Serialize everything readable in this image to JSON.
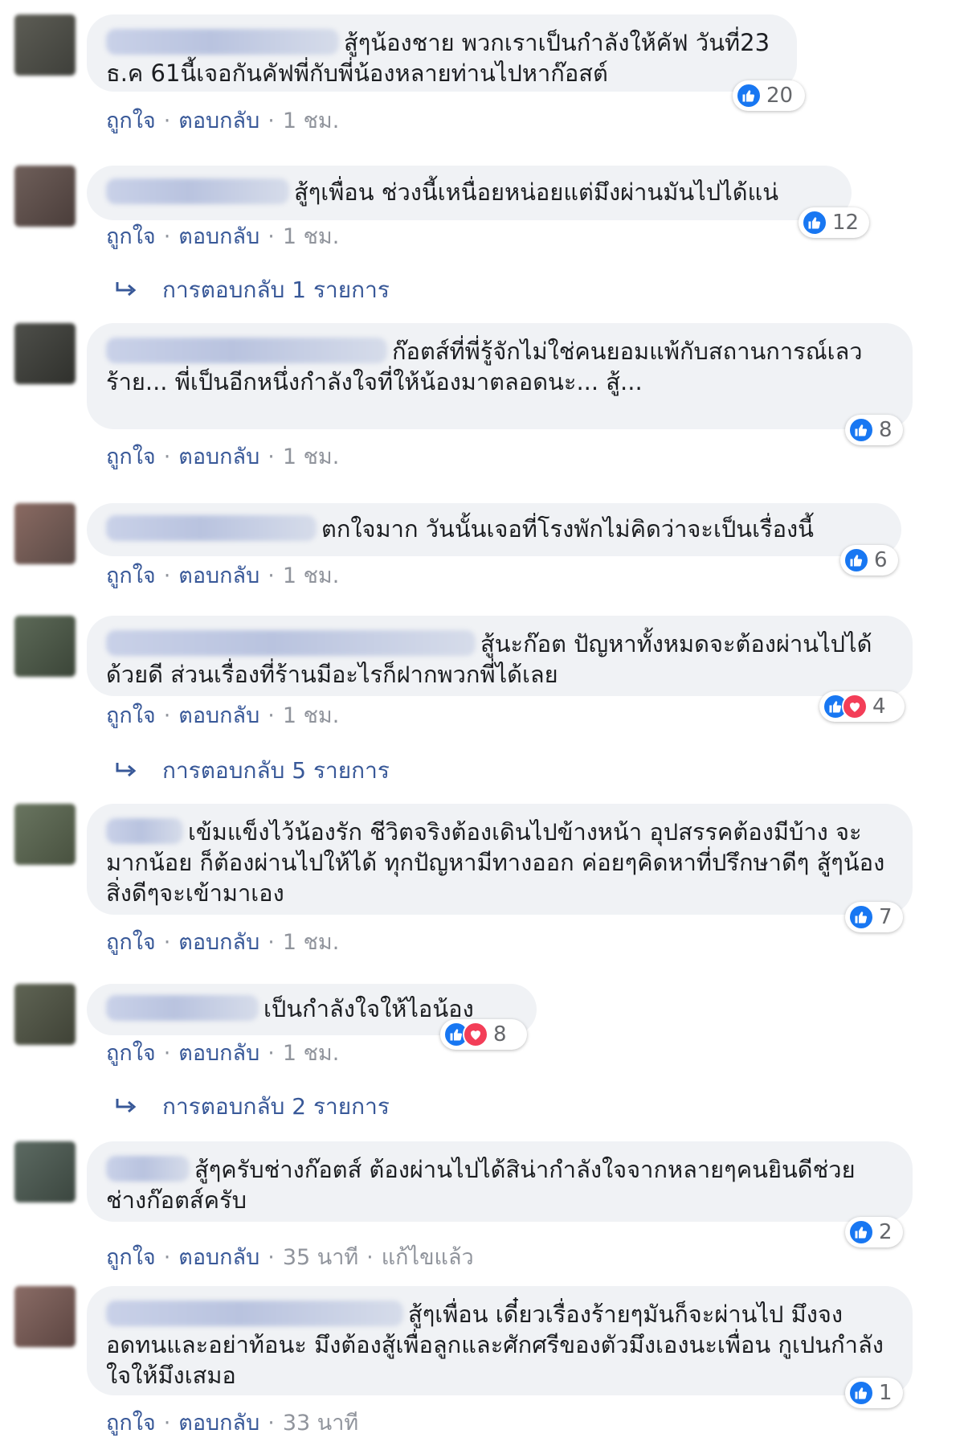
{
  "labels": {
    "like": "ถูกใจ",
    "reply": "ตอบกลับ",
    "separator": "·",
    "edited": "แก้ไขแล้ว"
  },
  "colors": {
    "like_blue": "#1877f2",
    "love_red": "#f33e58",
    "link_blue": "#385898",
    "meta_gray": "#90949c",
    "bubble_gray": "#f0f2f5"
  },
  "icons": {
    "like": "thumbs-up-icon",
    "love": "heart-icon",
    "reply_arrow": "reply-arrow-icon"
  },
  "comments": [
    {
      "text": "สู้ๆน้องชาย พวกเราเป็นกำลังให้คัฟ วันที่23 ธ.ค 61นี้เจอกันคัฟพี่กับพี่น้องหลายท่านไปหาก๊อสต์",
      "reactions": [
        "like"
      ],
      "reaction_count": "20",
      "time": "1 ชม.",
      "replies_link": ""
    },
    {
      "text": "สู้ๆเพื่อน ช่วงนี้เหนื่อยหน่อยแต่มึงผ่านมันไปได้แน่",
      "reactions": [
        "like"
      ],
      "reaction_count": "12",
      "time": "1 ชม.",
      "replies_link": "การตอบกลับ 1 รายการ"
    },
    {
      "text": "ก๊อตส์ที่พี่รู้จักไม่ใช่คนยอมแพ้กับสถานการณ์เลวร้าย... พี่เป็นอีกหนึ่งกำลังใจที่ให้น้องมาตลอดนะ... สู้...",
      "reactions": [
        "like"
      ],
      "reaction_count": "8",
      "time": "1 ชม.",
      "replies_link": ""
    },
    {
      "text": "ตกใจมาก วันนั้นเจอที่โรงพักไม่คิดว่าจะเป็นเรื่องนี้",
      "reactions": [
        "like"
      ],
      "reaction_count": "6",
      "time": "1 ชม.",
      "replies_link": ""
    },
    {
      "text": "สู้นะก๊อต ปัญหาทั้งหมดจะต้องผ่านไปได้ด้วยดี ส่วนเรื่องที่ร้านมีอะไรก็ฝากพวกพี่ได้เลย",
      "reactions": [
        "like",
        "love"
      ],
      "reaction_count": "4",
      "time": "1 ชม.",
      "replies_link": "การตอบกลับ 5 รายการ"
    },
    {
      "text": "เข้มแข็งไว้น้องรัก ชีวิตจริงต้องเดินไปข้างหน้า อุปสรรคต้องมีบ้าง จะมากน้อย ก็ต้องผ่านไปให้ได้ ทุกปัญหามีทางออก ค่อยๆคิดหาที่ปรึกษาดีๆ สู้ๆน้อง สิ่งดีๆจะเข้ามาเอง",
      "reactions": [
        "like"
      ],
      "reaction_count": "7",
      "time": "1 ชม.",
      "replies_link": ""
    },
    {
      "text": "เป็นกำลังใจให้ไอน้อง",
      "reactions": [
        "like",
        "love"
      ],
      "reaction_count": "8",
      "time": "1 ชม.",
      "replies_link": "การตอบกลับ 2 รายการ"
    },
    {
      "text": "สู้ๆครับช่างก๊อตส์ ต้องผ่านไปได้สิน่ากำลังใจจากหลายๆคนยินดีช่วยช่างก๊อตส์ครับ",
      "reactions": [
        "like"
      ],
      "reaction_count": "2",
      "time": "35 นาที",
      "edited": true,
      "replies_link": ""
    },
    {
      "text": "สู้ๆเพื่อน เดี๋ยวเรื่องร้ายๆมันก็จะผ่านไป มึงจงอดทนและอย่าท้อนะ มึงต้องสู้เพื่อลูกและศักศรีของตัวมึงเองนะเพื่อน กูเปนกำลังใจให้มึงเสมอ",
      "reactions": [
        "like"
      ],
      "reaction_count": "1",
      "time": "33 นาที",
      "replies_link": ""
    }
  ]
}
